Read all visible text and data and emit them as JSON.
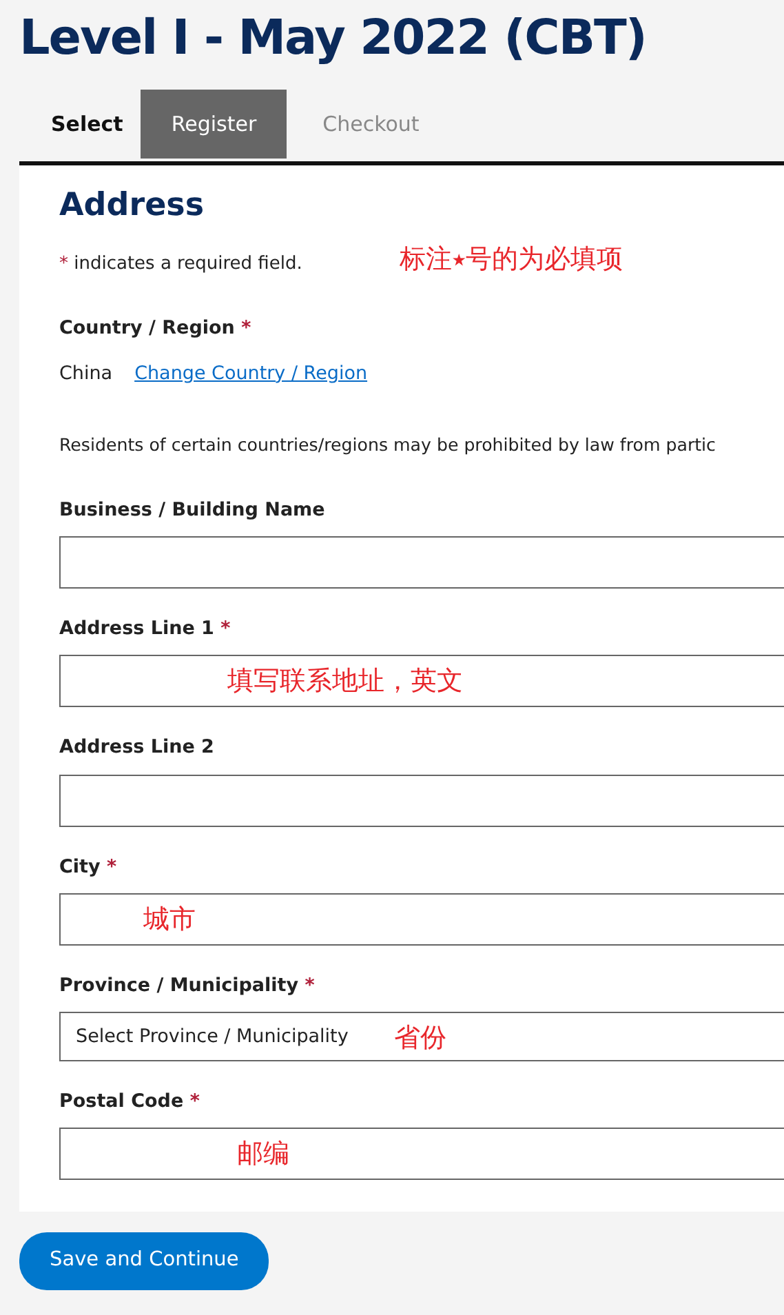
{
  "page_title": "Level I - May 2022 (CBT)",
  "steps": [
    {
      "label": "Select",
      "selected": false
    },
    {
      "label": "Register",
      "selected": true
    },
    {
      "label": "Checkout",
      "selected": false
    }
  ],
  "section": {
    "heading": "Address",
    "required_mark": "*",
    "required_note": "indicates a required field.",
    "annotation": "标注⭑号的为必填项"
  },
  "country": {
    "label": "Country / Region",
    "required": true,
    "value": "China",
    "link": "Change Country / Region"
  },
  "notice": "Residents of certain countries/regions may be prohibited by law from partic",
  "fields": [
    {
      "label": "Business / Building Name",
      "required": false,
      "kind": "input"
    },
    {
      "label": "Address Line 1",
      "required": true,
      "kind": "input",
      "annotation": "填写联系地址，英文"
    },
    {
      "label": "Address Line 2",
      "required": false,
      "kind": "input"
    },
    {
      "label": "City",
      "required": true,
      "kind": "input",
      "annotation": "城市"
    },
    {
      "label": "Province / Municipality",
      "required": true,
      "kind": "select",
      "value": "Select Province / Municipality",
      "annotation": "省份"
    },
    {
      "label": "Postal Code",
      "required": true,
      "kind": "input",
      "annotation": "邮编"
    }
  ],
  "submit": "Save and Continue"
}
